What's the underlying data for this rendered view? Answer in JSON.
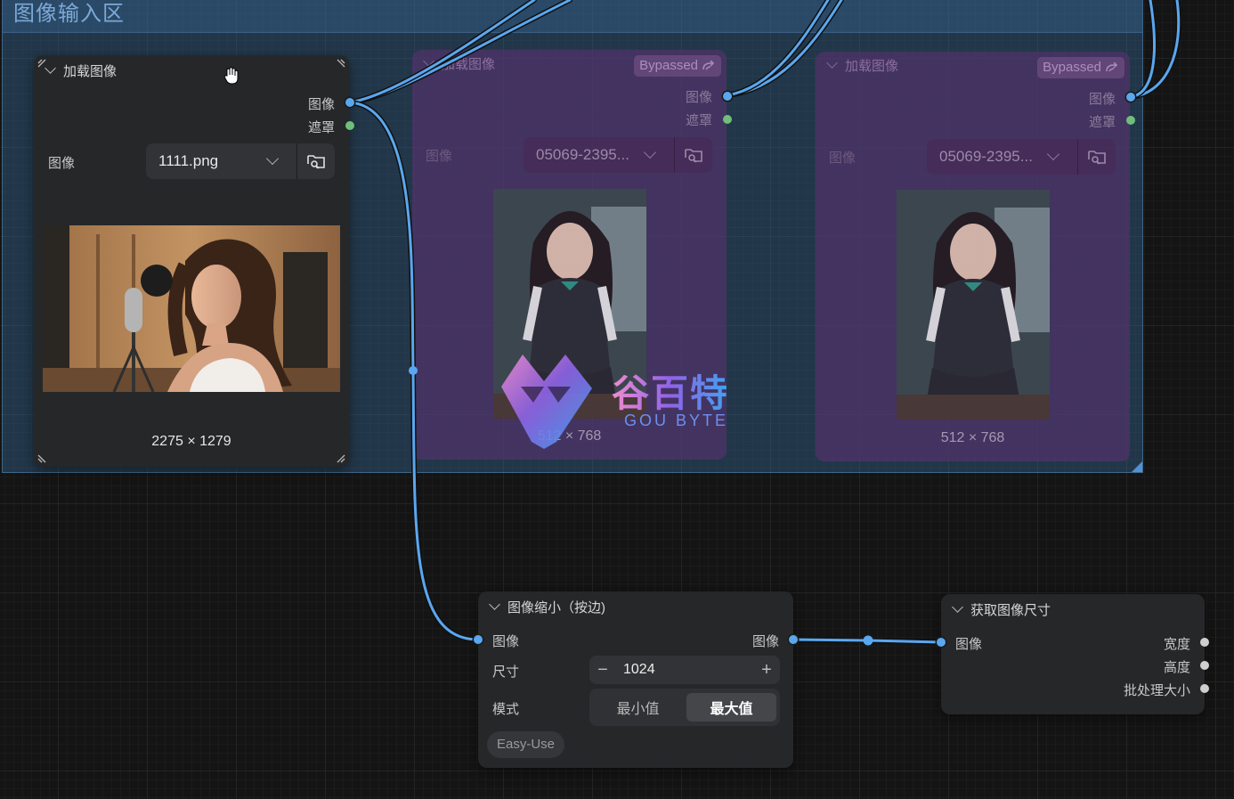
{
  "group": {
    "title": "图像输入区"
  },
  "load_image_1": {
    "title": "加载图像",
    "outputs": {
      "image": "图像",
      "mask": "遮罩"
    },
    "widget_label": "图像",
    "file": "1111.png",
    "dims": "2275 × 1279"
  },
  "load_image_2": {
    "title": "加载图像",
    "bypass_label": "Bypassed",
    "outputs": {
      "image": "图像",
      "mask": "遮罩"
    },
    "widget_label": "图像",
    "file": "05069-2395...",
    "dims": "512 × 768"
  },
  "load_image_3": {
    "title": "加载图像",
    "bypass_label": "Bypassed",
    "outputs": {
      "image": "图像",
      "mask": "遮罩"
    },
    "widget_label": "图像",
    "file": "05069-2395...",
    "dims": "512 × 768"
  },
  "resize_node": {
    "title": "图像缩小（按边)",
    "input": "图像",
    "output": "图像",
    "size_label": "尺寸",
    "size_value": "1024",
    "mode_label": "模式",
    "mode_options": [
      "最小值",
      "最大值"
    ],
    "mode_selected": "最大值",
    "badge": "Easy-Use"
  },
  "size_node": {
    "title": "获取图像尺寸",
    "input": "图像",
    "outputs": [
      "宽度",
      "高度",
      "批处理大小"
    ]
  },
  "watermark": {
    "brand": "谷百特",
    "sub": "GOU BYTE"
  },
  "colors": {
    "image_link": "#5aa7ef",
    "mask_socket": "#6fbf7a",
    "bypass_node": "#58306f",
    "group_fill": "#38709f"
  },
  "icons": [
    "chevron-down-icon",
    "folder-search-icon",
    "bypass-icon",
    "resize-handle-icon",
    "hand-cursor-icon",
    "minus-icon",
    "plus-icon"
  ]
}
